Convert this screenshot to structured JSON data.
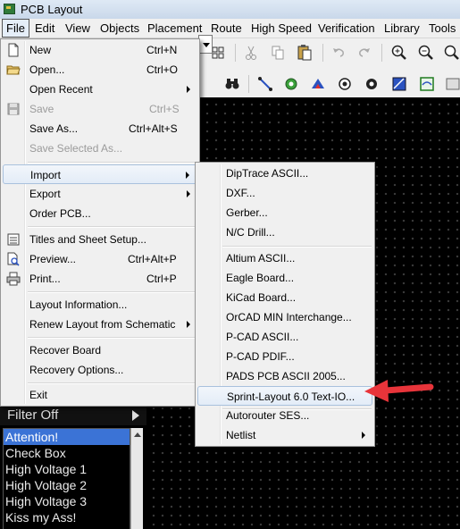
{
  "window": {
    "title": "PCB Layout"
  },
  "menubar": [
    "File",
    "Edit",
    "View",
    "Objects",
    "Placement",
    "Route",
    "High Speed",
    "Verification",
    "Library",
    "Tools"
  ],
  "file_menu": {
    "new": {
      "label": "New",
      "shortcut": "Ctrl+N"
    },
    "open": {
      "label": "Open...",
      "shortcut": "Ctrl+O"
    },
    "open_recent": {
      "label": "Open Recent"
    },
    "save": {
      "label": "Save",
      "shortcut": "Ctrl+S"
    },
    "save_as": {
      "label": "Save As...",
      "shortcut": "Ctrl+Alt+S"
    },
    "save_selected": {
      "label": "Save Selected As..."
    },
    "import": {
      "label": "Import"
    },
    "export": {
      "label": "Export"
    },
    "order_pcb": {
      "label": "Order PCB..."
    },
    "titles": {
      "label": "Titles and Sheet Setup..."
    },
    "preview": {
      "label": "Preview...",
      "shortcut": "Ctrl+Alt+P"
    },
    "print": {
      "label": "Print...",
      "shortcut": "Ctrl+P"
    },
    "layout_info": {
      "label": "Layout Information..."
    },
    "renew": {
      "label": "Renew Layout from Schematic"
    },
    "recover": {
      "label": "Recover Board"
    },
    "recovery_options": {
      "label": "Recovery Options..."
    },
    "exit": {
      "label": "Exit"
    }
  },
  "import_menu": [
    "DipTrace ASCII...",
    "DXF...",
    "Gerber...",
    "N/C Drill...",
    "Altium ASCII...",
    "Eagle Board...",
    "KiCad Board...",
    "OrCAD MIN Interchange...",
    "P-CAD ASCII...",
    "P-CAD PDIF...",
    "PADS PCB ASCII 2005...",
    "Sprint-Layout 6.0 Text-IO...",
    "Autorouter SES...",
    "Netlist"
  ],
  "left_panel": {
    "filter": "Filter Off",
    "layers": [
      "Attention!",
      "Check Box",
      "High Voltage 1",
      "High Voltage 2",
      "High Voltage 3",
      "Kiss my Ass!"
    ]
  },
  "colors": {
    "highlight": "#3b73d6",
    "annotation_arrow": "#e8343a",
    "canvas": "#000000"
  }
}
